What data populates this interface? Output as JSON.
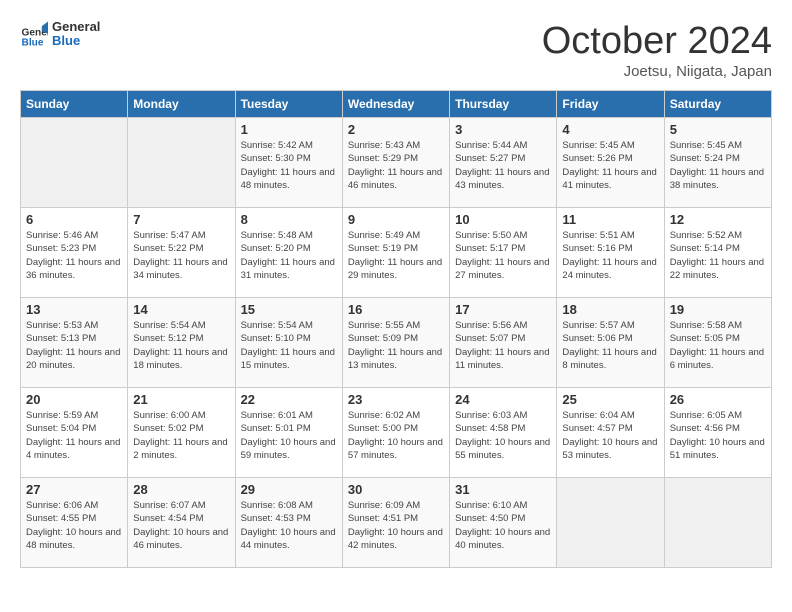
{
  "header": {
    "logo_general": "General",
    "logo_blue": "Blue",
    "title": "October 2024",
    "subtitle": "Joetsu, Niigata, Japan"
  },
  "days_of_week": [
    "Sunday",
    "Monday",
    "Tuesday",
    "Wednesday",
    "Thursday",
    "Friday",
    "Saturday"
  ],
  "weeks": [
    [
      {
        "day": "",
        "info": ""
      },
      {
        "day": "",
        "info": ""
      },
      {
        "day": "1",
        "info": "Sunrise: 5:42 AM\nSunset: 5:30 PM\nDaylight: 11 hours and 48 minutes."
      },
      {
        "day": "2",
        "info": "Sunrise: 5:43 AM\nSunset: 5:29 PM\nDaylight: 11 hours and 46 minutes."
      },
      {
        "day": "3",
        "info": "Sunrise: 5:44 AM\nSunset: 5:27 PM\nDaylight: 11 hours and 43 minutes."
      },
      {
        "day": "4",
        "info": "Sunrise: 5:45 AM\nSunset: 5:26 PM\nDaylight: 11 hours and 41 minutes."
      },
      {
        "day": "5",
        "info": "Sunrise: 5:45 AM\nSunset: 5:24 PM\nDaylight: 11 hours and 38 minutes."
      }
    ],
    [
      {
        "day": "6",
        "info": "Sunrise: 5:46 AM\nSunset: 5:23 PM\nDaylight: 11 hours and 36 minutes."
      },
      {
        "day": "7",
        "info": "Sunrise: 5:47 AM\nSunset: 5:22 PM\nDaylight: 11 hours and 34 minutes."
      },
      {
        "day": "8",
        "info": "Sunrise: 5:48 AM\nSunset: 5:20 PM\nDaylight: 11 hours and 31 minutes."
      },
      {
        "day": "9",
        "info": "Sunrise: 5:49 AM\nSunset: 5:19 PM\nDaylight: 11 hours and 29 minutes."
      },
      {
        "day": "10",
        "info": "Sunrise: 5:50 AM\nSunset: 5:17 PM\nDaylight: 11 hours and 27 minutes."
      },
      {
        "day": "11",
        "info": "Sunrise: 5:51 AM\nSunset: 5:16 PM\nDaylight: 11 hours and 24 minutes."
      },
      {
        "day": "12",
        "info": "Sunrise: 5:52 AM\nSunset: 5:14 PM\nDaylight: 11 hours and 22 minutes."
      }
    ],
    [
      {
        "day": "13",
        "info": "Sunrise: 5:53 AM\nSunset: 5:13 PM\nDaylight: 11 hours and 20 minutes."
      },
      {
        "day": "14",
        "info": "Sunrise: 5:54 AM\nSunset: 5:12 PM\nDaylight: 11 hours and 18 minutes."
      },
      {
        "day": "15",
        "info": "Sunrise: 5:54 AM\nSunset: 5:10 PM\nDaylight: 11 hours and 15 minutes."
      },
      {
        "day": "16",
        "info": "Sunrise: 5:55 AM\nSunset: 5:09 PM\nDaylight: 11 hours and 13 minutes."
      },
      {
        "day": "17",
        "info": "Sunrise: 5:56 AM\nSunset: 5:07 PM\nDaylight: 11 hours and 11 minutes."
      },
      {
        "day": "18",
        "info": "Sunrise: 5:57 AM\nSunset: 5:06 PM\nDaylight: 11 hours and 8 minutes."
      },
      {
        "day": "19",
        "info": "Sunrise: 5:58 AM\nSunset: 5:05 PM\nDaylight: 11 hours and 6 minutes."
      }
    ],
    [
      {
        "day": "20",
        "info": "Sunrise: 5:59 AM\nSunset: 5:04 PM\nDaylight: 11 hours and 4 minutes."
      },
      {
        "day": "21",
        "info": "Sunrise: 6:00 AM\nSunset: 5:02 PM\nDaylight: 11 hours and 2 minutes."
      },
      {
        "day": "22",
        "info": "Sunrise: 6:01 AM\nSunset: 5:01 PM\nDaylight: 10 hours and 59 minutes."
      },
      {
        "day": "23",
        "info": "Sunrise: 6:02 AM\nSunset: 5:00 PM\nDaylight: 10 hours and 57 minutes."
      },
      {
        "day": "24",
        "info": "Sunrise: 6:03 AM\nSunset: 4:58 PM\nDaylight: 10 hours and 55 minutes."
      },
      {
        "day": "25",
        "info": "Sunrise: 6:04 AM\nSunset: 4:57 PM\nDaylight: 10 hours and 53 minutes."
      },
      {
        "day": "26",
        "info": "Sunrise: 6:05 AM\nSunset: 4:56 PM\nDaylight: 10 hours and 51 minutes."
      }
    ],
    [
      {
        "day": "27",
        "info": "Sunrise: 6:06 AM\nSunset: 4:55 PM\nDaylight: 10 hours and 48 minutes."
      },
      {
        "day": "28",
        "info": "Sunrise: 6:07 AM\nSunset: 4:54 PM\nDaylight: 10 hours and 46 minutes."
      },
      {
        "day": "29",
        "info": "Sunrise: 6:08 AM\nSunset: 4:53 PM\nDaylight: 10 hours and 44 minutes."
      },
      {
        "day": "30",
        "info": "Sunrise: 6:09 AM\nSunset: 4:51 PM\nDaylight: 10 hours and 42 minutes."
      },
      {
        "day": "31",
        "info": "Sunrise: 6:10 AM\nSunset: 4:50 PM\nDaylight: 10 hours and 40 minutes."
      },
      {
        "day": "",
        "info": ""
      },
      {
        "day": "",
        "info": ""
      }
    ]
  ]
}
